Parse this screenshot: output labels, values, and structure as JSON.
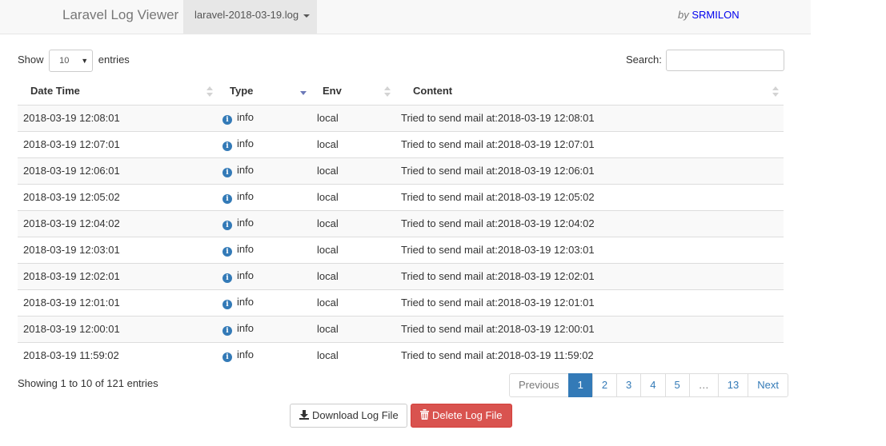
{
  "navbar": {
    "brand": "Laravel Log Viewer",
    "file_selector": "laravel-2018-03-19.log",
    "by": "by",
    "author": "SRMILON"
  },
  "length": {
    "show_label": "Show",
    "selected": "10",
    "entries_label": "entries"
  },
  "search": {
    "label": "Search:",
    "value": ""
  },
  "table": {
    "headers": [
      "Date Time",
      "Type",
      "Env",
      "Content"
    ],
    "sorted_column": "Type",
    "rows": [
      {
        "datetime": "2018-03-19 12:08:01",
        "type": "info",
        "env": "local",
        "content": "Tried to send mail at:2018-03-19 12:08:01"
      },
      {
        "datetime": "2018-03-19 12:07:01",
        "type": "info",
        "env": "local",
        "content": "Tried to send mail at:2018-03-19 12:07:01"
      },
      {
        "datetime": "2018-03-19 12:06:01",
        "type": "info",
        "env": "local",
        "content": "Tried to send mail at:2018-03-19 12:06:01"
      },
      {
        "datetime": "2018-03-19 12:05:02",
        "type": "info",
        "env": "local",
        "content": "Tried to send mail at:2018-03-19 12:05:02"
      },
      {
        "datetime": "2018-03-19 12:04:02",
        "type": "info",
        "env": "local",
        "content": "Tried to send mail at:2018-03-19 12:04:02"
      },
      {
        "datetime": "2018-03-19 12:03:01",
        "type": "info",
        "env": "local",
        "content": "Tried to send mail at:2018-03-19 12:03:01"
      },
      {
        "datetime": "2018-03-19 12:02:01",
        "type": "info",
        "env": "local",
        "content": "Tried to send mail at:2018-03-19 12:02:01"
      },
      {
        "datetime": "2018-03-19 12:01:01",
        "type": "info",
        "env": "local",
        "content": "Tried to send mail at:2018-03-19 12:01:01"
      },
      {
        "datetime": "2018-03-19 12:00:01",
        "type": "info",
        "env": "local",
        "content": "Tried to send mail at:2018-03-19 12:00:01"
      },
      {
        "datetime": "2018-03-19 11:59:02",
        "type": "info",
        "env": "local",
        "content": "Tried to send mail at:2018-03-19 11:59:02"
      }
    ]
  },
  "info": "Showing 1 to 10 of 121 entries",
  "pagination": {
    "previous": "Previous",
    "pages": [
      "1",
      "2",
      "3",
      "4",
      "5",
      "…",
      "13"
    ],
    "active": "1",
    "next": "Next"
  },
  "buttons": {
    "download": "Download Log File",
    "delete": "Delete Log File"
  },
  "icons": {
    "type": "info-circle-icon",
    "download": "download-icon",
    "delete": "trash-icon"
  },
  "colors": {
    "link": "#337ab7",
    "danger": "#d9534f",
    "navbar_bg": "#f8f8f8",
    "author_link": "#0000ee"
  }
}
